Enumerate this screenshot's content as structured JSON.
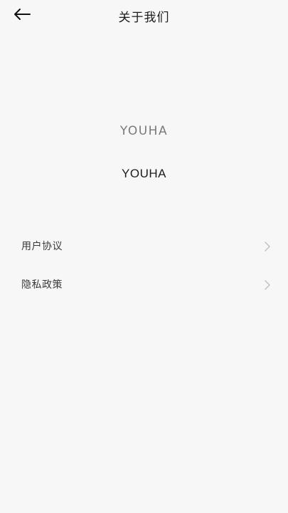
{
  "header": {
    "title": "关于我们",
    "back_icon": "arrow-left-icon"
  },
  "logo": {
    "wordmark": "YOUHA"
  },
  "app": {
    "name": "YOUHA"
  },
  "menu": {
    "items": [
      {
        "label": "用户协议",
        "icon": "chevron-right-icon"
      },
      {
        "label": "隐私政策",
        "icon": "chevron-right-icon"
      }
    ]
  },
  "colors": {
    "background": "#f7f7f7",
    "text_primary": "#1b1b1b",
    "text_secondary": "#3a3a3a",
    "logo_gray": "#7a7a7a",
    "chevron": "#bdbdbd"
  }
}
